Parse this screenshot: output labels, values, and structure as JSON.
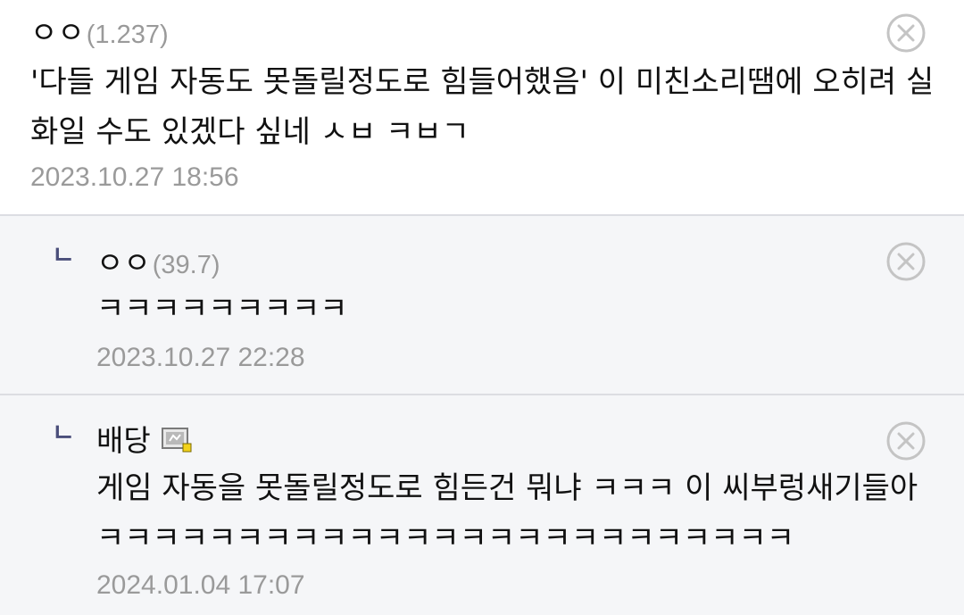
{
  "comments": [
    {
      "author": "ㅇㅇ",
      "ip": "(1.237)",
      "lines": [
        "'다들 게임 자동도 못돌릴정도로 힘들어했음' 이 미친소리땜에 오히려 실",
        "화일 수도 있겠다 싶네 ㅅㅂ ㅋㅂㄱ"
      ],
      "date": "2023.10.27 18:56"
    },
    {
      "reply_mark": "ㄴ",
      "author": "ㅇㅇ",
      "ip": "(39.7)",
      "lines": [
        "ㅋㅋㅋㅋㅋㅋㅋㅋㅋ"
      ],
      "date": "2023.10.27 22:28"
    },
    {
      "reply_mark": "ㄴ",
      "author": "배당",
      "lines": [
        "게임 자동을 못돌릴정도로 힘든건 뭐냐 ㅋㅋㅋ 이 씨부렁새기들아",
        "ㅋㅋㅋㅋㅋㅋㅋㅋㅋㅋㅋㅋㅋㅋㅋㅋㅋㅋㅋㅋㅋㅋㅋㅋㅋ"
      ],
      "date": "2024.01.04 17:07"
    }
  ],
  "icons": {
    "delete": "close-circle-icon",
    "fixed_nick": "fixed-nickname-icon"
  },
  "colors": {
    "text": "#111111",
    "meta": "#9a9a9a",
    "reply_mark": "#4a4e7a",
    "reply_bg": "#f5f6f8",
    "divider": "#dcdde2"
  }
}
